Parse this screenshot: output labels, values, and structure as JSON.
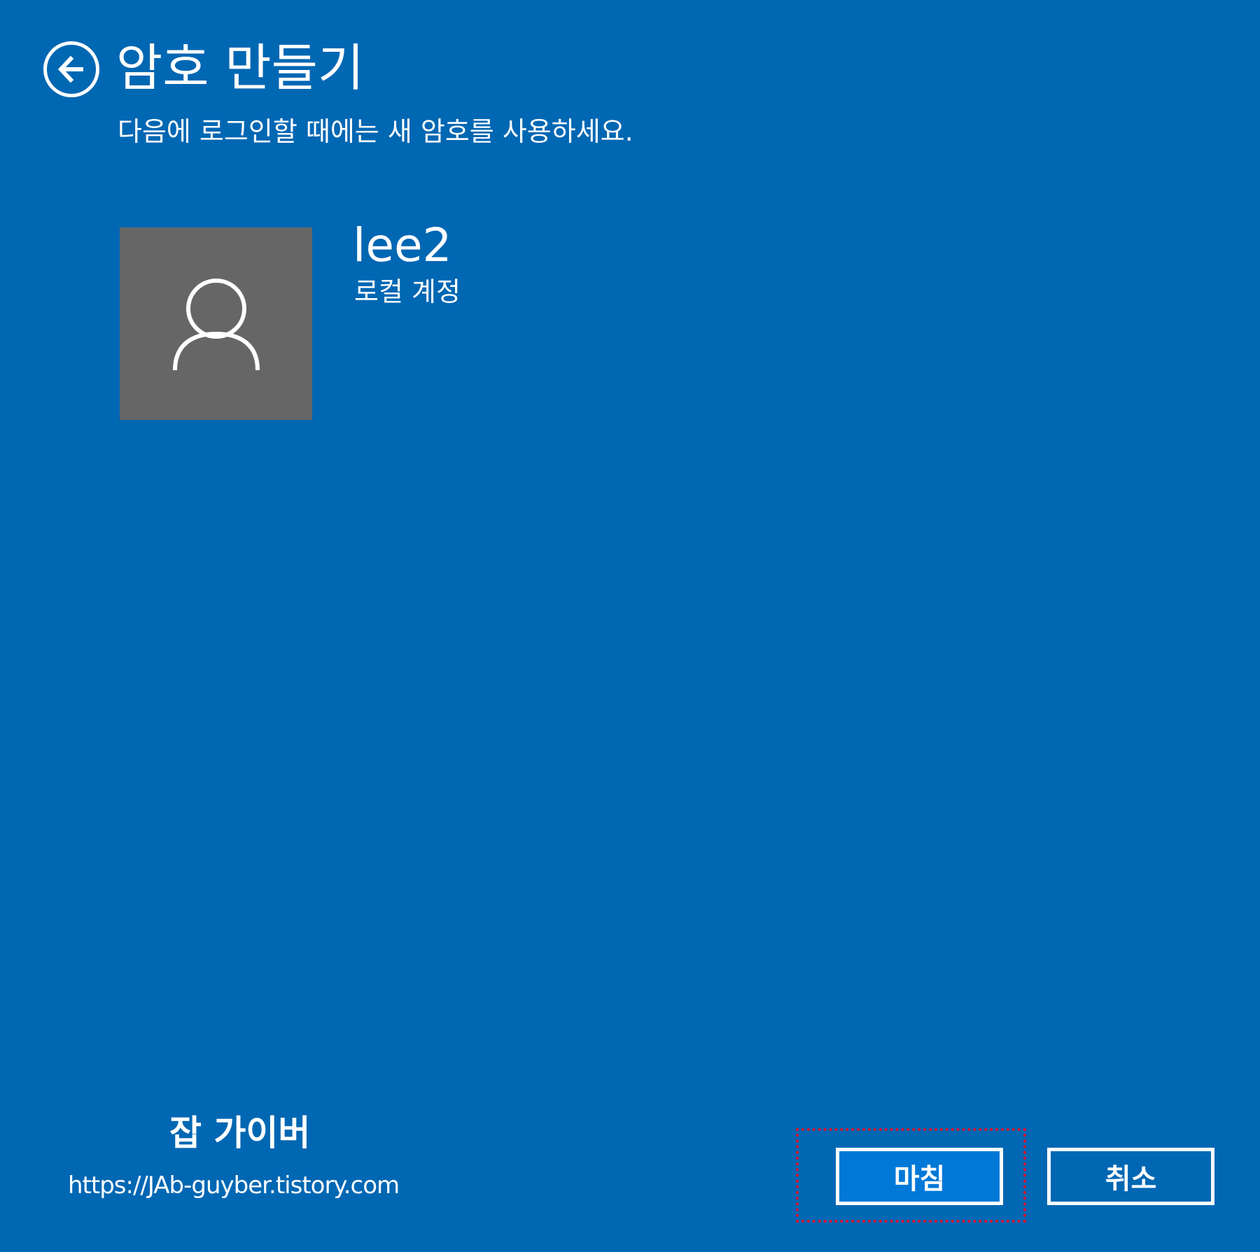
{
  "colors": {
    "background": "#0067b3",
    "primary_button": "#0078d7",
    "avatar_bg": "#666666",
    "focus_outline": "#e0122b",
    "text": "#ffffff"
  },
  "header": {
    "back_icon": "arrow-left-circle-icon",
    "title": "암호 만들기",
    "subtitle": "다음에 로그인할 때에는 새 암호를 사용하세요."
  },
  "account": {
    "avatar_icon": "user-icon",
    "name": "lee2",
    "type": "로컬 계정"
  },
  "watermark": {
    "name": "잡 가이버",
    "url": "https://JAb-guyber.tistory.com"
  },
  "footer": {
    "finish_label": "마침",
    "cancel_label": "취소"
  }
}
